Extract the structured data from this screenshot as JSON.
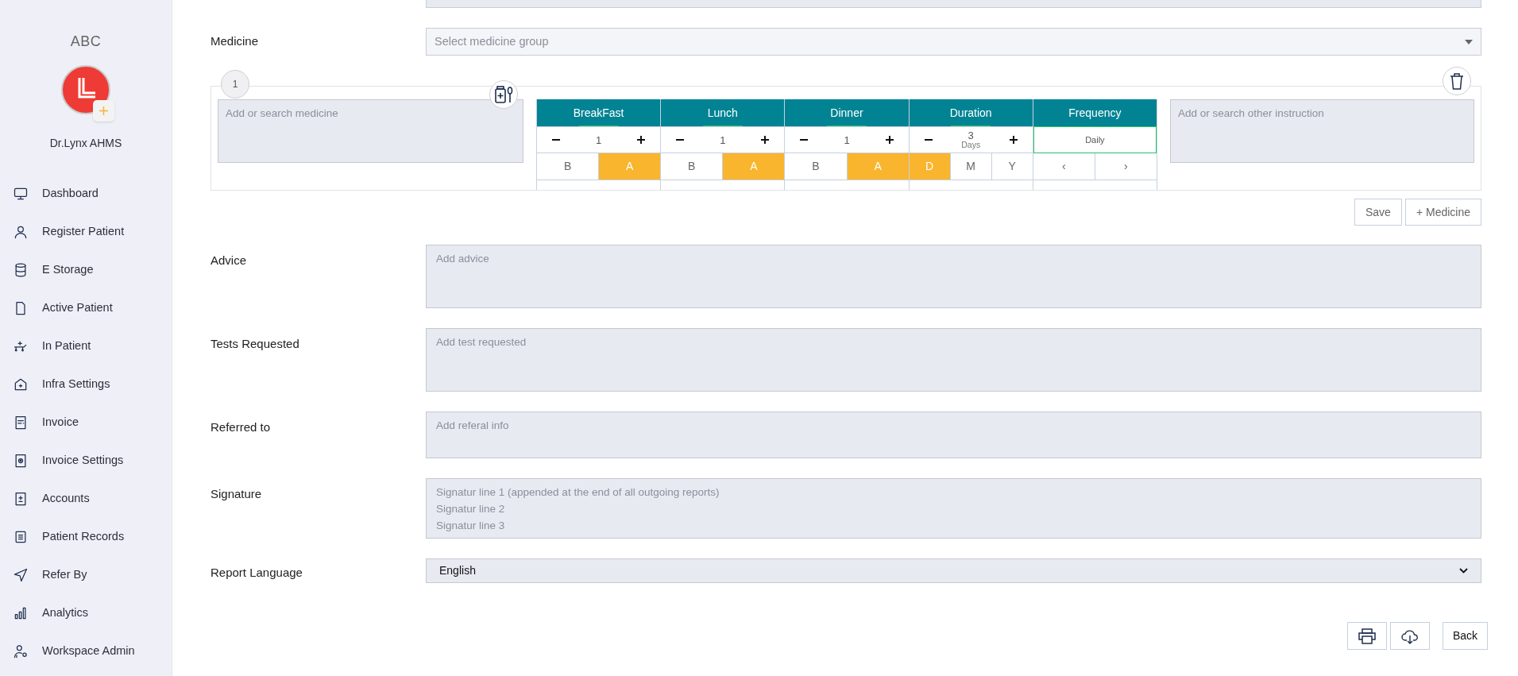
{
  "sidebar": {
    "org_name": "ABC",
    "user_name": "Dr.Lynx AHMS",
    "items": [
      {
        "label": "Dashboard"
      },
      {
        "label": "Register Patient"
      },
      {
        "label": "E Storage"
      },
      {
        "label": "Active Patient"
      },
      {
        "label": "In Patient"
      },
      {
        "label": "Infra Settings"
      },
      {
        "label": "Invoice"
      },
      {
        "label": "Invoice Settings"
      },
      {
        "label": "Accounts"
      },
      {
        "label": "Patient Records"
      },
      {
        "label": "Refer By"
      },
      {
        "label": "Analytics"
      },
      {
        "label": "Workspace Admin"
      }
    ]
  },
  "medicine": {
    "label": "Medicine",
    "placeholder": "Select medicine group"
  },
  "medicine_entries": [
    {
      "number": "1",
      "medicine_placeholder": "Add or search medicine",
      "instruction_placeholder": "Add or search other instruction",
      "schedule": [
        {
          "kind": "counter",
          "header": "BreakFast",
          "value": "1",
          "options": [
            {
              "label": "B",
              "selected": false
            },
            {
              "label": "A",
              "selected": true
            }
          ]
        },
        {
          "kind": "counter",
          "header": "Lunch",
          "value": "1",
          "options": [
            {
              "label": "B",
              "selected": false
            },
            {
              "label": "A",
              "selected": true
            }
          ]
        },
        {
          "kind": "counter",
          "header": "Dinner",
          "value": "1",
          "options": [
            {
              "label": "B",
              "selected": false
            },
            {
              "label": "A",
              "selected": true
            }
          ]
        },
        {
          "kind": "counter",
          "header": "Duration",
          "value": "3",
          "unit": "Days",
          "options": [
            {
              "label": "D",
              "selected": true
            },
            {
              "label": "M",
              "selected": false
            },
            {
              "label": "Y",
              "selected": false
            }
          ]
        },
        {
          "kind": "select",
          "header": "Frequency",
          "value": "Daily",
          "options": [
            {
              "label": "‹",
              "selected": false
            },
            {
              "label": "›",
              "selected": false
            }
          ]
        }
      ]
    }
  ],
  "medicine_actions": [
    "Save",
    "+ Medicine"
  ],
  "fields": [
    {
      "kind": "textarea",
      "label": "Advice",
      "placeholder": "Add advice"
    },
    {
      "kind": "textarea",
      "label": "Tests Requested",
      "placeholder": "Add test requested"
    },
    {
      "kind": "textarea",
      "label": "Referred to",
      "placeholder": "Add referal info"
    },
    {
      "kind": "textarea",
      "label": "Signature",
      "placeholder": "Signatur line 1 (appended at the end of all outgoing reports)\nSignatur line 2\nSignatur line 3"
    },
    {
      "kind": "select",
      "label": "Report Language",
      "value": "English"
    }
  ],
  "footer_buttons": [
    {
      "kind": "print"
    },
    {
      "kind": "download"
    },
    {
      "kind": "text",
      "label": "Back"
    }
  ]
}
